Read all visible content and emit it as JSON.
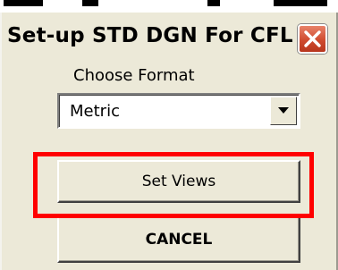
{
  "dialog": {
    "title": "Set-up STD DGN For CFL",
    "close_icon": "close-icon"
  },
  "format": {
    "label": "Choose Format",
    "selected": "Metric",
    "dropdown_icon": "chevron-down-icon"
  },
  "buttons": {
    "set_views": "Set Views",
    "cancel": "CANCEL"
  },
  "colors": {
    "highlight": "#ff0000",
    "dialog_bg": "#ece9d8",
    "close_button": "#d04b2f"
  }
}
